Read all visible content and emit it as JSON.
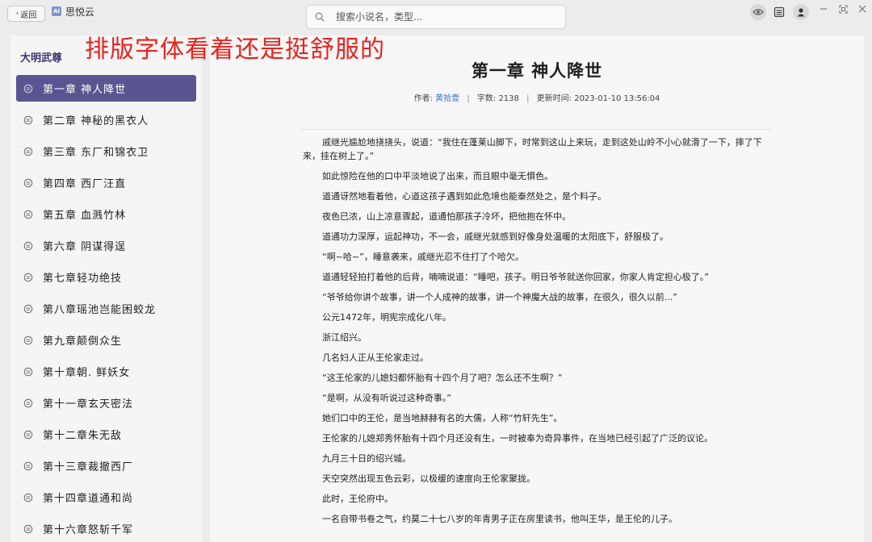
{
  "titlebar": {
    "back_label": "返回",
    "app_name": "思悦云",
    "logo_text": "AI"
  },
  "search": {
    "placeholder": "搜索小说名，类型..."
  },
  "overlay_text": "排版字体看着还是挺舒服的",
  "sidebar": {
    "book_title": "大明武尊",
    "chapters": [
      {
        "label": "第一章 神人降世",
        "active": true
      },
      {
        "label": "第二章 神秘的黑衣人"
      },
      {
        "label": "第三章 东厂和锦衣卫"
      },
      {
        "label": "第四章 西厂汪直"
      },
      {
        "label": "第五章 血溅竹林"
      },
      {
        "label": "第六章 阴谋得逞"
      },
      {
        "label": "第七章轻功绝技"
      },
      {
        "label": "第八章瑶池岂能困蛟龙"
      },
      {
        "label": "第九章颠倒众生"
      },
      {
        "label": "第十章朝. 鲜妖女"
      },
      {
        "label": "第十一章玄天密法"
      },
      {
        "label": "第十二章朱无敌"
      },
      {
        "label": "第十三章裁撤西厂"
      },
      {
        "label": "第十四章道通和尚"
      },
      {
        "label": "第十六章怒斩千军"
      }
    ]
  },
  "reader": {
    "chapter_title": "第一章 神人降世",
    "meta": {
      "author_label": "作者:",
      "author": "黄拾壹",
      "words_label": "字数:",
      "words": "2138",
      "updated_label": "更新时间:",
      "updated": "2023-01-10 13:56:04"
    },
    "paragraphs": [
      "戚继光尴尬地挠挠头，说道：“我住在蓬莱山脚下，时常到这山上来玩，走到这处山岭不小心就滑了一下，摔了下来，挂在树上了。”",
      "如此惊险在他的口中平淡地说了出来，而且眼中毫无惧色。",
      "道通讶然地看着他，心道这孩子遇到如此危境也能泰然处之，是个料子。",
      "夜色已浓，山上凉意骤起，道通怕那孩子冷坏，把他抱在怀中。",
      "道通功力深厚，运起神功，不一会，戚继光就感到好像身处温暖的太阳底下，舒服极了。",
      "“啊~哈~”，睡意袭来，戚继光忍不住打了个哈欠。",
      "道通轻轻拍打着他的后背，喃喃说道：“睡吧，孩子。明日爷爷就送你回家，你家人肯定担心极了。”",
      "“爷爷给你讲个故事，讲一个人成神的故事，讲一个神魔大战的故事，在很久，很久以前...”",
      "公元1472年，明宪宗成化八年。",
      "浙江绍兴。",
      "几名妇人正从王伦家走过。",
      "“这王伦家的儿媳妇都怀胎有十四个月了吧？怎么还不生啊？”",
      "“是啊，从没有听说过这种奇事。”",
      "她们口中的王伦，是当地赫赫有名的大儒，人称“竹轩先生”。",
      "王伦家的儿媳郑秀怀胎有十四个月还没有生，一时被奉为奇异事件，在当地已经引起了广泛的议论。",
      "九月三十日的绍兴城。",
      "天空突然出现五色云彩，以极缓的速度向王伦家聚拢。",
      "此时，王伦府中。",
      "一名自带书卷之气，约莫二十七八岁的年青男子正在房里读书，他叫王华，是王伦的儿子。"
    ]
  }
}
